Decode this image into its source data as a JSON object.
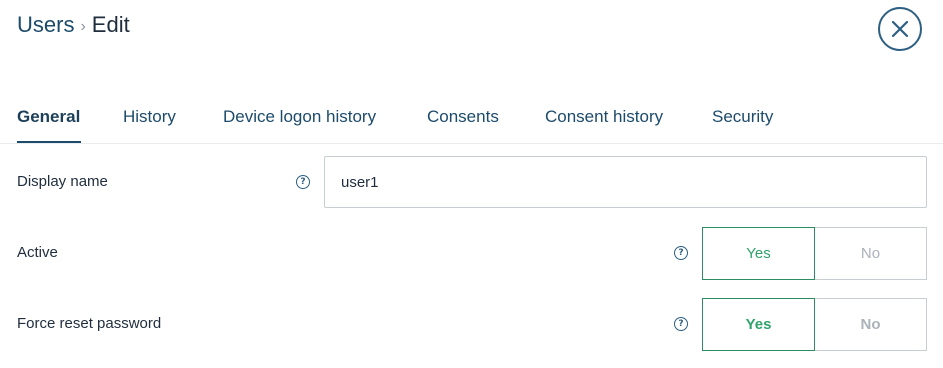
{
  "breadcrumb": {
    "parent": "Users",
    "separator": "›",
    "current": "Edit"
  },
  "close_icon": "close-icon",
  "tabs": [
    {
      "label": "General",
      "active": true
    },
    {
      "label": "History",
      "active": false
    },
    {
      "label": "Device logon history",
      "active": false
    },
    {
      "label": "Consents",
      "active": false
    },
    {
      "label": "Consent history",
      "active": false
    },
    {
      "label": "Security",
      "active": false
    }
  ],
  "form": {
    "display_name": {
      "label": "Display name",
      "value": "user1"
    },
    "active": {
      "label": "Active",
      "yes": "Yes",
      "no": "No",
      "selected": "Yes"
    },
    "force_reset": {
      "label": "Force reset password",
      "yes": "Yes",
      "no": "No",
      "selected": "Yes"
    }
  },
  "help_glyph": "?",
  "colors": {
    "primary": "#1c4b6b",
    "success": "#2fa36b",
    "muted": "#aab2ba"
  }
}
